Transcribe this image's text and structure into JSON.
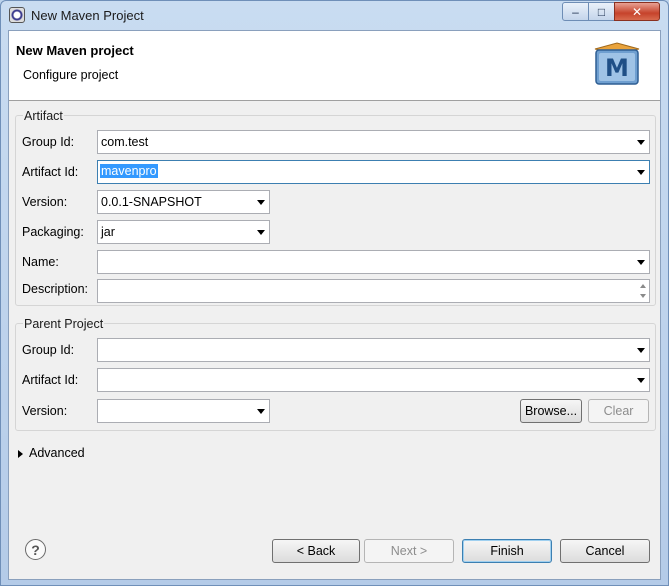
{
  "window": {
    "title": "New Maven Project",
    "minimize_glyph": "–",
    "maximize_glyph": "□",
    "close_glyph": "✕"
  },
  "header": {
    "title": "New Maven project",
    "subtitle": "Configure project",
    "logo_letter": "M"
  },
  "artifact": {
    "label": "Artifact",
    "group_id": {
      "label": "Group Id:",
      "value": "com.test"
    },
    "artifact_id": {
      "label": "Artifact Id:",
      "value": "mavenpro"
    },
    "version": {
      "label": "Version:",
      "value": "0.0.1-SNAPSHOT"
    },
    "packaging": {
      "label": "Packaging:",
      "value": "jar"
    },
    "name": {
      "label": "Name:",
      "value": ""
    },
    "description": {
      "label": "Description:",
      "value": ""
    }
  },
  "parent": {
    "label": "Parent Project",
    "group_id": {
      "label": "Group Id:",
      "value": ""
    },
    "artifact_id": {
      "label": "Artifact Id:",
      "value": ""
    },
    "version": {
      "label": "Version:",
      "value": ""
    },
    "browse_label": "Browse...",
    "clear_label": "Clear"
  },
  "advanced": {
    "label": "Advanced"
  },
  "footer": {
    "help_glyph": "?",
    "back_label": "< Back",
    "next_label": "Next >",
    "finish_label": "Finish",
    "cancel_label": "Cancel"
  },
  "colors": {
    "accent": "#3399ff",
    "title_bar": "#c9dcf1",
    "close_button": "#c6432b"
  }
}
